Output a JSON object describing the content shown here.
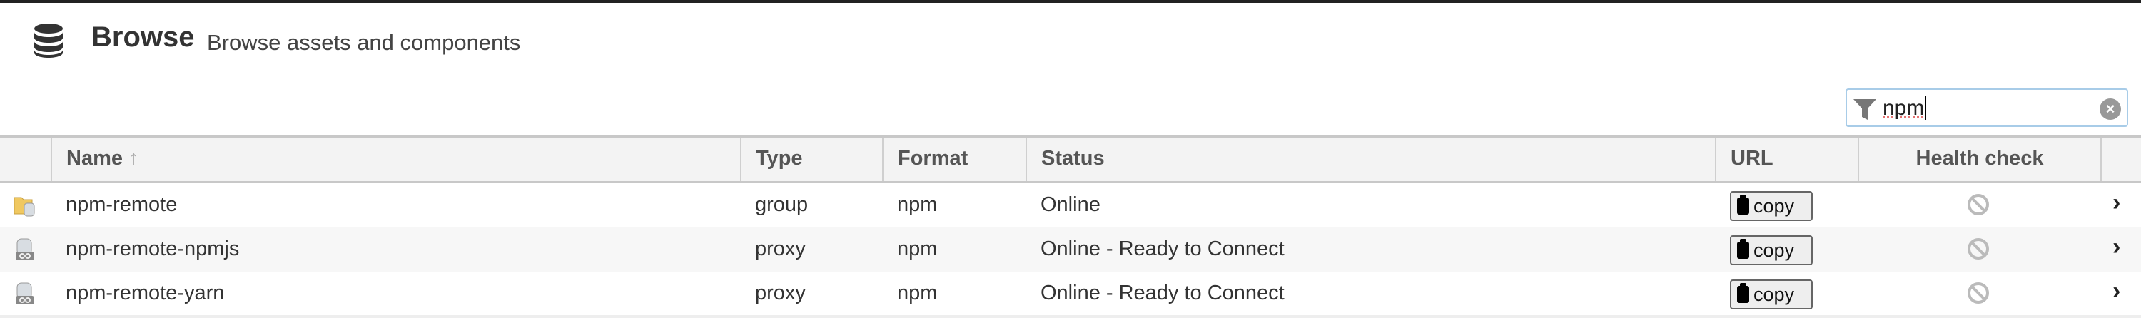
{
  "header": {
    "icon": "database-icon",
    "title": "Browse",
    "subtitle": "Browse assets and components"
  },
  "filter": {
    "icon": "filter-icon",
    "value": "npm",
    "clear_icon": "clear-icon"
  },
  "table": {
    "columns": [
      "Name",
      "Type",
      "Format",
      "Status",
      "URL",
      "Health check"
    ],
    "sort": {
      "column": "Name",
      "direction": "ascending",
      "icon": "arrow-up-icon"
    },
    "rows": [
      {
        "icon": "group-repo-icon",
        "name": "npm-remote",
        "type": "group",
        "format": "npm",
        "status": "Online",
        "url_button": "copy",
        "health": "disabled-icon"
      },
      {
        "icon": "proxy-repo-icon",
        "name": "npm-remote-npmjs",
        "type": "proxy",
        "format": "npm",
        "status": "Online - Ready to Connect",
        "url_button": "copy",
        "health": "disabled-icon"
      },
      {
        "icon": "proxy-repo-icon",
        "name": "npm-remote-yarn",
        "type": "proxy",
        "format": "npm",
        "status": "Online - Ready to Connect",
        "url_button": "copy",
        "health": "disabled-icon"
      }
    ]
  }
}
